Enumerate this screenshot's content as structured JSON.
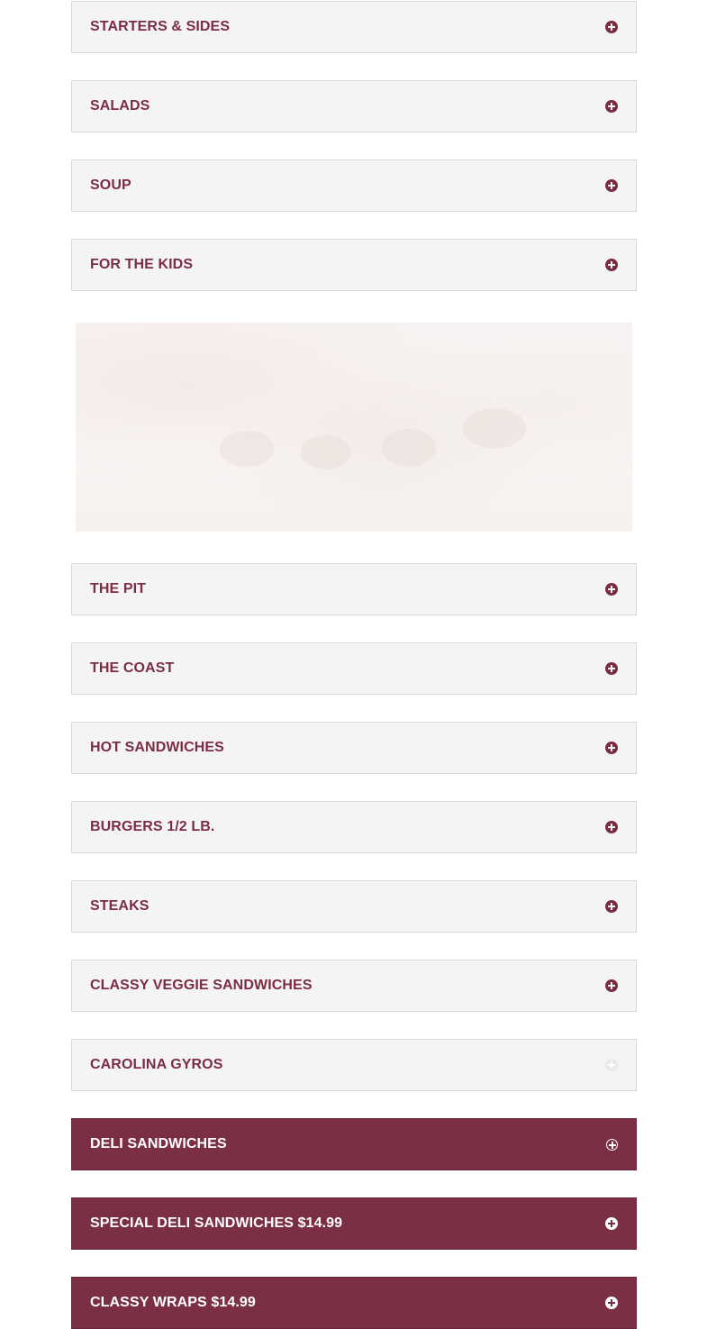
{
  "accordion": {
    "items": [
      {
        "label": "STARTERS & SIDES",
        "icon": "plus-circle-icon"
      },
      {
        "label": "SALADS",
        "icon": "plus-circle-icon"
      },
      {
        "label": "SOUP",
        "icon": "plus-circle-icon"
      },
      {
        "label": "FOR THE KIDS",
        "icon": "plus-circle-icon"
      },
      {
        "label": "THE PIT",
        "icon": "plus-circle-icon"
      },
      {
        "label": "THE COAST",
        "icon": "plus-circle-icon"
      },
      {
        "label": "HOT SANDWICHES",
        "icon": "plus-circle-icon"
      },
      {
        "label": "BURGERS 1/2 LB.",
        "icon": "plus-circle-icon"
      },
      {
        "label": "STEAKS",
        "icon": "plus-circle-icon"
      },
      {
        "label": "CLASSY VEGGIE SANDWICHES",
        "icon": "plus-circle-icon"
      },
      {
        "label": "CAROLINA GYROS",
        "icon": "plus-circle-icon"
      },
      {
        "label": "DELI SANDWICHES",
        "icon": "plus-circle-icon"
      },
      {
        "label": "SPECIAL DELI SANDWICHES $14.99",
        "icon": "plus-circle-icon"
      },
      {
        "label": "CLASSY WRAPS $14.99",
        "icon": "plus-circle-icon"
      }
    ]
  },
  "colors": {
    "accent": "#7b2d43",
    "header_bg": "#f4f4f4",
    "active_bg": "#7a2f45"
  },
  "image": {
    "icon": "food-photo"
  }
}
